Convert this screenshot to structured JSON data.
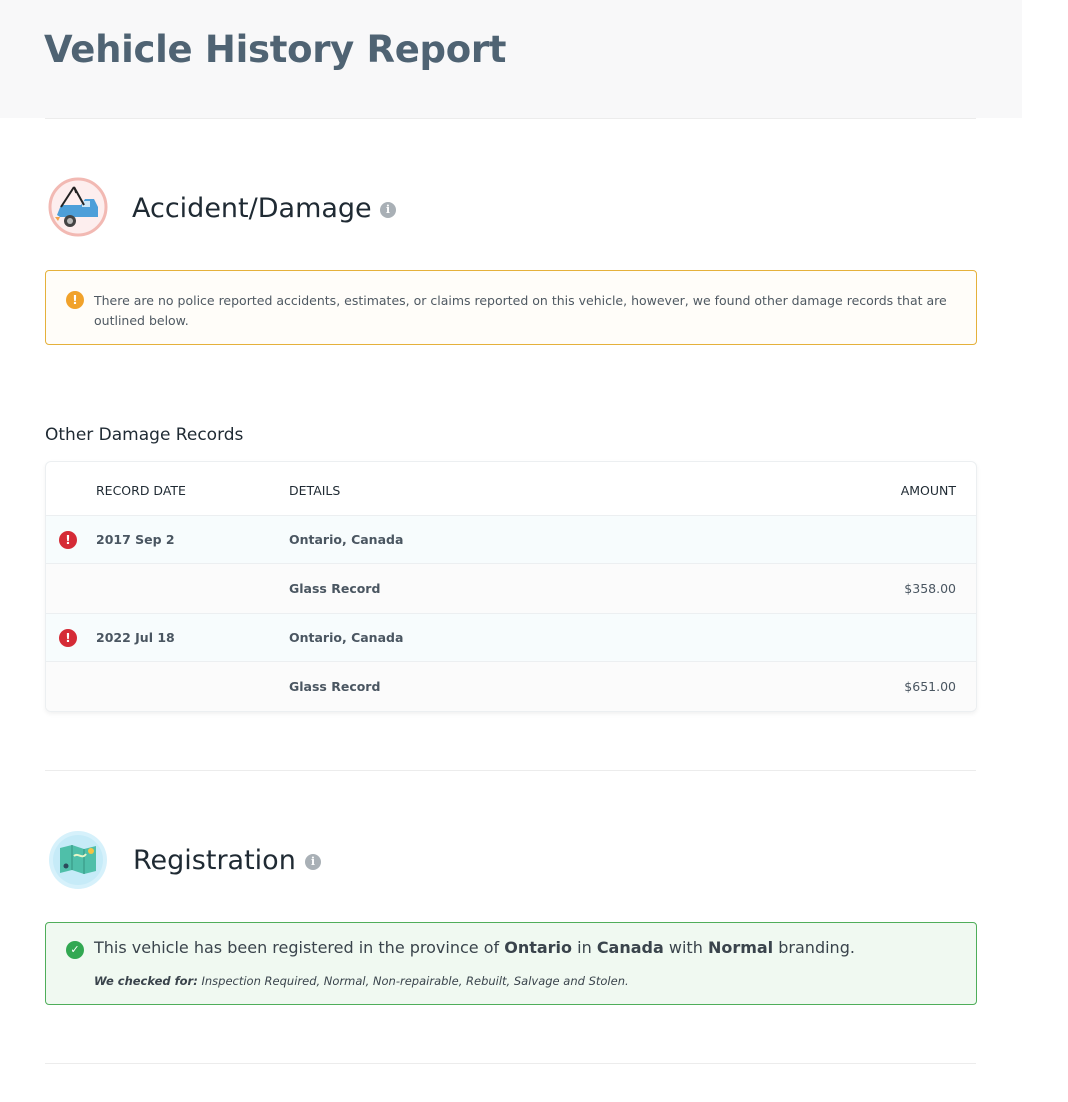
{
  "header": {
    "title": "Vehicle History Report"
  },
  "accident": {
    "title": "Accident/Damage",
    "icon": "tow-truck-icon",
    "info_icon_glyph": "i",
    "warning_glyph": "!",
    "warning_text": "There are no police reported accidents, estimates, or claims reported on this vehicle, however, we found other damage records that are outlined below.",
    "records_title": "Other Damage Records",
    "columns": [
      "RECORD DATE",
      "DETAILS",
      "AMOUNT"
    ],
    "records": [
      {
        "date": "2017 Sep 2",
        "location": "Ontario, Canada",
        "detail": "Glass Record",
        "amount": "$358.00"
      },
      {
        "date": "2022 Jul 18",
        "location": "Ontario, Canada",
        "detail": "Glass Record",
        "amount": "$651.00"
      }
    ],
    "error_glyph": "!"
  },
  "registration": {
    "title": "Registration",
    "icon": "map-icon",
    "info_icon_glyph": "i",
    "success_glyph": "✓",
    "text_prefix": "This vehicle has been registered in the province of",
    "province": "Ontario",
    "text_in": "in",
    "country": "Canada",
    "text_with": "with",
    "branding": "Normal",
    "text_suffix": "branding.",
    "checked_label": "We checked for:",
    "checked_values": "Inspection Required, Normal, Non-repairable, Rebuilt, Salvage and Stolen."
  },
  "colors": {
    "title": "#4f6373",
    "warning_border": "#e5b13b",
    "warning_icon": "#f1a22b",
    "error_icon": "#d52b36",
    "success_border": "#4fae5a",
    "success_icon": "#32a852",
    "success_bg": "#f0f9f1"
  }
}
